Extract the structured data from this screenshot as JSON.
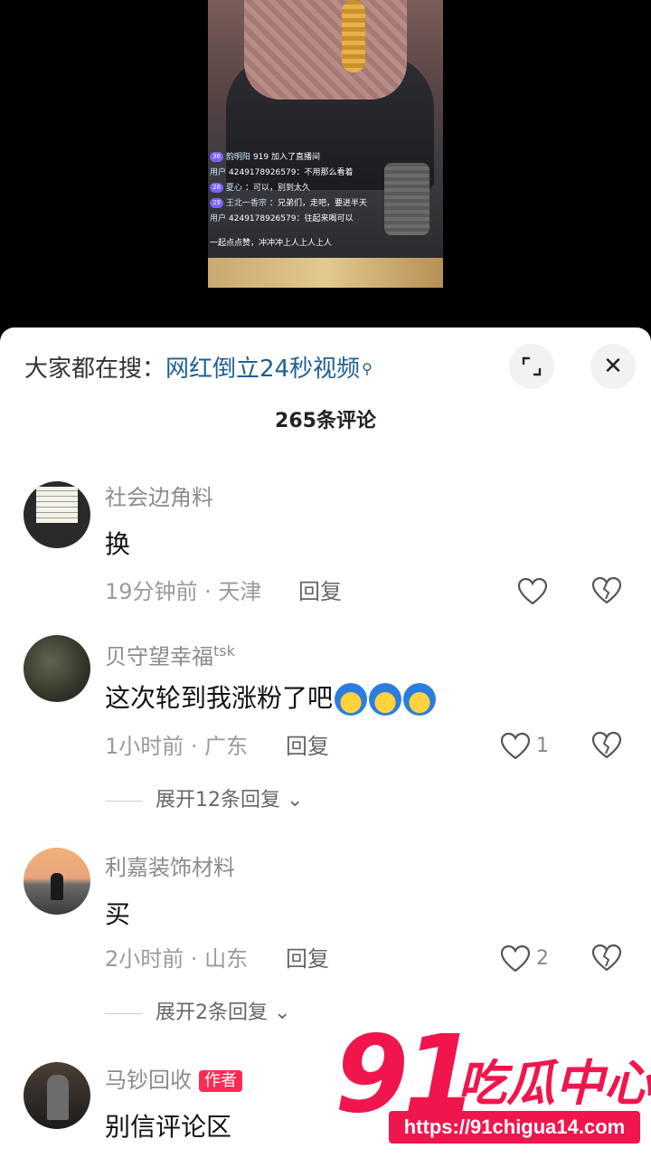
{
  "video": {
    "chat": [
      {
        "level": "36",
        "name": "韵明阳",
        "text": "919 加入了直播间"
      },
      {
        "level": "",
        "name": "用户",
        "text": "4249178926579：不用那么看着"
      },
      {
        "level": "26",
        "name": "夏心",
        "text": "：可以，别到太久"
      },
      {
        "level": "29",
        "name": "王北一香宗",
        "text": "：兄弟们，走吧，要进半天"
      },
      {
        "level": "",
        "name": "用户",
        "text": "4249178926579：往起来喝可以"
      },
      {
        "level": "",
        "name": "",
        "text": "一起点点赞，冲冲冲上人上人上人"
      }
    ]
  },
  "sheet": {
    "search_prefix": "大家都在搜：",
    "search_term": "网红倒立24秒视频",
    "expand_icon": "⌐",
    "close_icon": "✕",
    "comment_count": "265条评论"
  },
  "comments": [
    {
      "username": "社会边角料",
      "content": "换",
      "time": "19分钟前 · 天津",
      "reply": "回复",
      "likes": ""
    },
    {
      "username": "贝守望幸福",
      "username_sup": "tsk",
      "content": "这次轮到我涨粉了吧",
      "time": "1小时前 · 广东",
      "reply": "回复",
      "likes": "1",
      "expand": "展开12条回复"
    },
    {
      "username": "利嘉装饰材料",
      "content": "买",
      "time": "2小时前 · 山东",
      "reply": "回复",
      "likes": "2",
      "expand": "展开2条回复"
    },
    {
      "username": "马钞回收",
      "badge": "作者",
      "content": "别信评论区"
    }
  ],
  "watermark": {
    "number": "91",
    "text": "吃瓜中心",
    "url": "https://91chigua14.com"
  },
  "colors": {
    "accent_blue": "#1f5f93",
    "brand_red": "#f0164d",
    "author_badge": "#fe2c55"
  }
}
